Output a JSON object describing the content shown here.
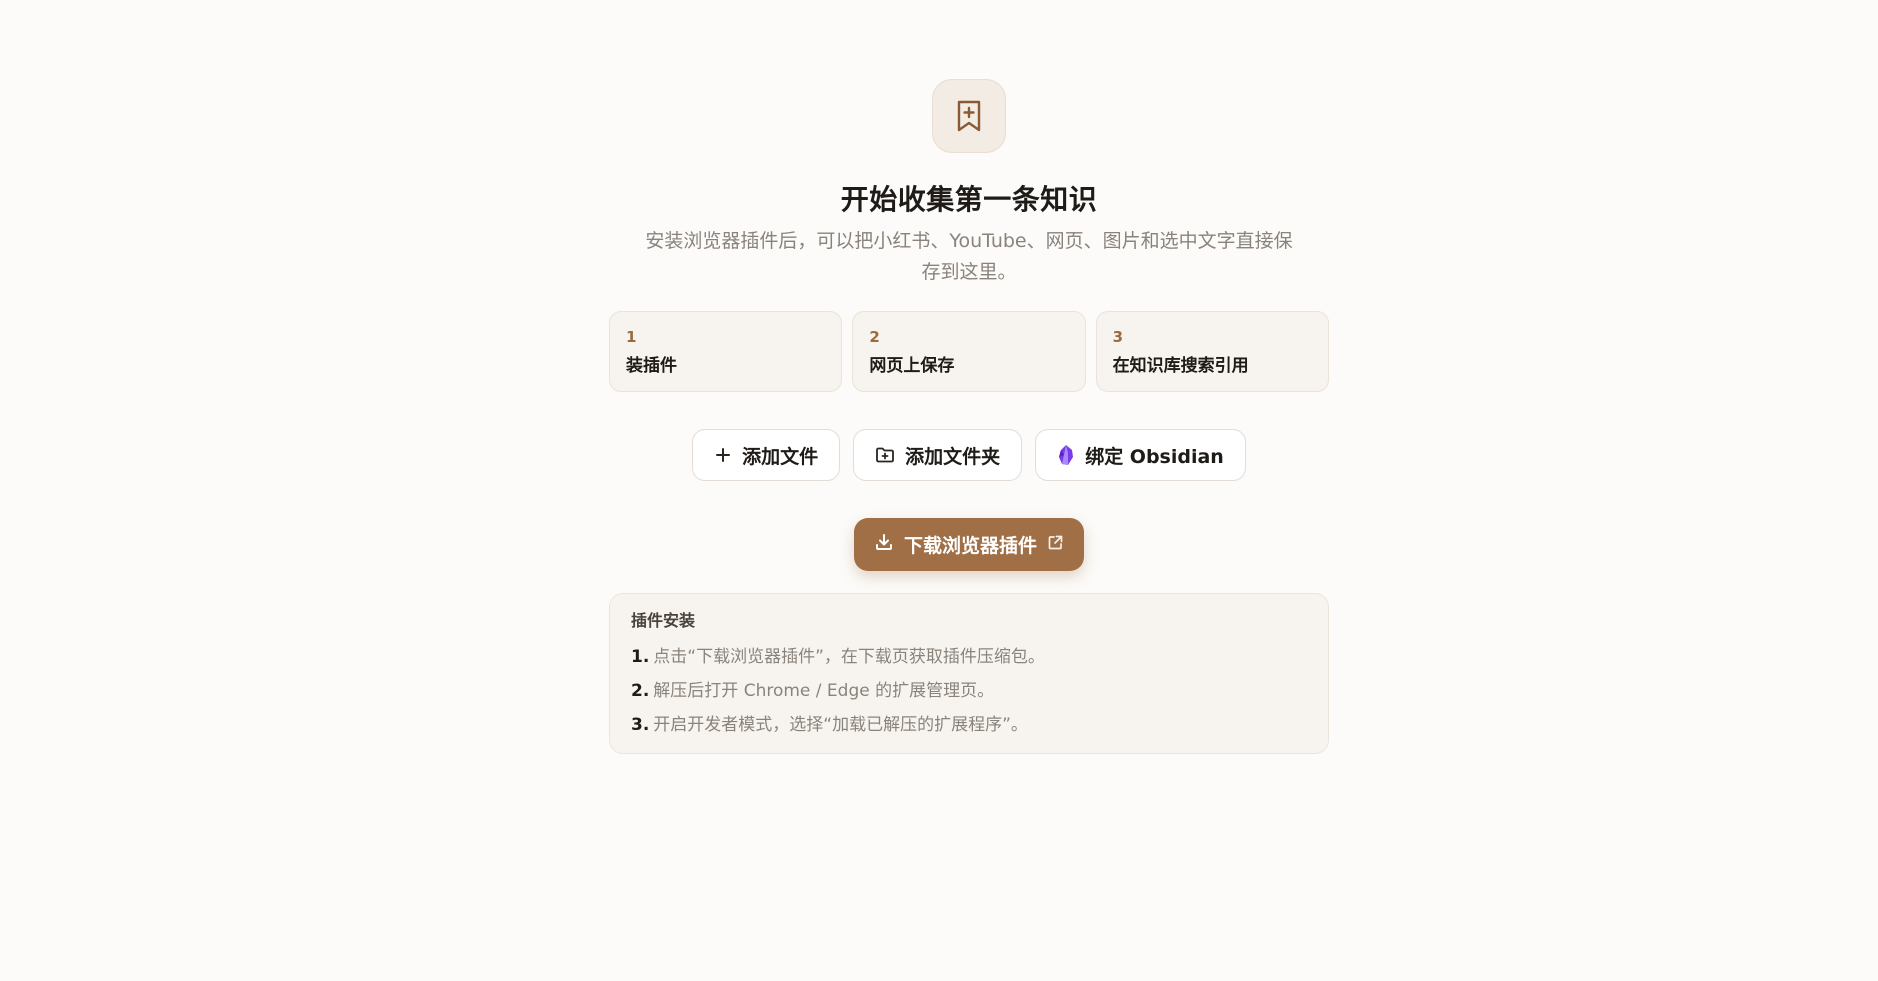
{
  "hero": {
    "icon": "bookmark-plus-icon",
    "title": "开始收集第一条知识",
    "subtitle": "安装浏览器插件后，可以把小红书、YouTube、网页、图片和选中文字直接保存到这里。"
  },
  "steps": [
    {
      "num": "1",
      "label": "装插件"
    },
    {
      "num": "2",
      "label": "网页上保存"
    },
    {
      "num": "3",
      "label": "在知识库搜索引用"
    }
  ],
  "actions": {
    "add_file": {
      "label": "添加文件",
      "icon": "plus-icon"
    },
    "add_folder": {
      "label": "添加文件夹",
      "icon": "folder-plus-icon"
    },
    "bind_obsidian": {
      "label": "绑定 Obsidian",
      "icon": "obsidian-icon"
    }
  },
  "primary": {
    "label": "下载浏览器插件",
    "icon": "download-icon",
    "trailing_icon": "external-link-icon"
  },
  "guide": {
    "title": "插件安装",
    "items": [
      {
        "num": "1.",
        "text": "点击“下载浏览器插件”，在下载页获取插件压缩包。"
      },
      {
        "num": "2.",
        "text": "解压后打开 Chrome / Edge 的扩展管理页。"
      },
      {
        "num": "3.",
        "text": "开启开发者模式，选择“加载已解压的扩展程序”。"
      }
    ]
  },
  "colors": {
    "background": "#fcfbf9",
    "accent": "#a06f45",
    "step_number": "#9a6b3f",
    "obsidian": "#7c3aed"
  }
}
